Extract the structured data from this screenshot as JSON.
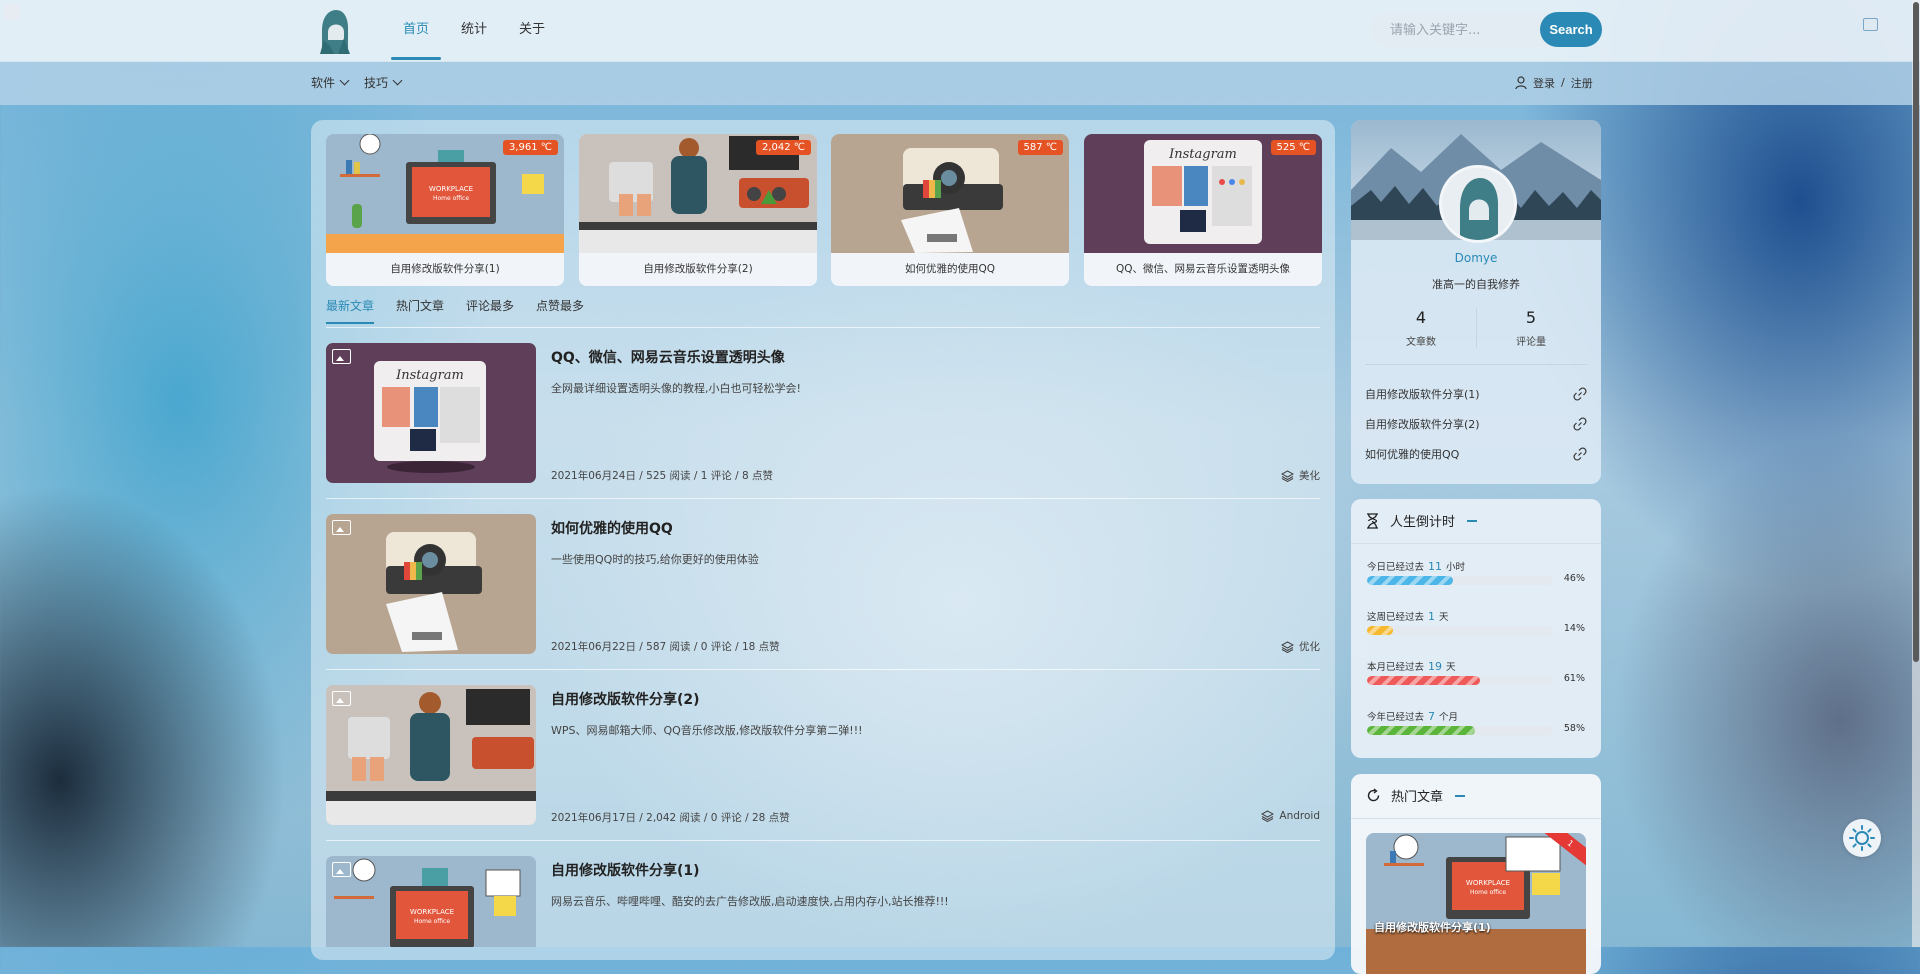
{
  "nav": {
    "items": [
      {
        "label": "首页",
        "active": true
      },
      {
        "label": "统计"
      },
      {
        "label": "关于"
      }
    ]
  },
  "search": {
    "placeholder": "请输入关键字...",
    "button": "Search"
  },
  "submenu": [
    {
      "label": "软件"
    },
    {
      "label": "技巧"
    }
  ],
  "auth": {
    "login": "登录",
    "sep": "/",
    "register": "注册"
  },
  "featured": [
    {
      "title": "自用修改版软件分享(1)",
      "temp": "3,961 ℃"
    },
    {
      "title": "自用修改版软件分享(2)",
      "temp": "2,042 ℃"
    },
    {
      "title": "如何优雅的使用QQ",
      "temp": "587 ℃"
    },
    {
      "title": "QQ、微信、网易云音乐设置透明头像",
      "temp": "525 ℃"
    }
  ],
  "tabs": [
    {
      "label": "最新文章",
      "active": true
    },
    {
      "label": "热门文章"
    },
    {
      "label": "评论最多"
    },
    {
      "label": "点赞最多"
    }
  ],
  "posts": [
    {
      "title": "QQ、微信、网易云音乐设置透明头像",
      "desc": "全网最详细设置透明头像的教程,小白也可轻松学会!",
      "meta": "2021年06月24日 / 525 阅读 / 1 评论 / 8 点赞",
      "tag": "美化"
    },
    {
      "title": "如何优雅的使用QQ",
      "desc": "一些使用QQ时的技巧,给你更好的使用体验",
      "meta": "2021年06月22日 / 587 阅读 / 0 评论 / 18 点赞",
      "tag": "优化"
    },
    {
      "title": "自用修改版软件分享(2)",
      "desc": "WPS、网易邮箱大师、QQ音乐修改版,修改版软件分享第二弹!!!",
      "meta": "2021年06月17日 / 2,042 阅读 / 0 评论 / 28 点赞",
      "tag": "Android"
    },
    {
      "title": "自用修改版软件分享(1)",
      "desc": "网易云音乐、哔哩哔哩、酷安的去广告修改版,启动速度快,占用内存小,站长推荐!!!",
      "meta": "",
      "tag": ""
    }
  ],
  "profile": {
    "name": "Domye",
    "motto": "准高一的自我修养",
    "articles": {
      "value": "4",
      "label": "文章数"
    },
    "comments": {
      "value": "5",
      "label": "评论量"
    },
    "links": [
      "自用修改版软件分享(1)",
      "自用修改版软件分享(2)",
      "如何优雅的使用QQ"
    ]
  },
  "countdown": {
    "title": "人生倒计时",
    "rows": [
      {
        "prefix": "今日已经过去",
        "num": "11",
        "unit": "小时",
        "percent": 46,
        "pct_text": "46%",
        "color": "#4db6e8"
      },
      {
        "prefix": "这周已经过去",
        "num": "1",
        "unit": "天",
        "percent": 14,
        "pct_text": "14%",
        "color": "#f5b82e"
      },
      {
        "prefix": "本月已经过去",
        "num": "19",
        "unit": "天",
        "percent": 61,
        "pct_text": "61%",
        "color": "#ee5a5a"
      },
      {
        "prefix": "今年已经过去",
        "num": "7",
        "unit": "个月",
        "percent": 58,
        "pct_text": "58%",
        "color": "#5bb53a"
      }
    ]
  },
  "hot": {
    "title": "热门文章",
    "cover_title": "自用修改版软件分享(1)",
    "rank": "1"
  },
  "colors": {
    "accent": "#2a8ab5",
    "temp_badge": "#e55325"
  },
  "icons": {
    "theme": "sun-icon",
    "user": "user-icon",
    "tag": "layers-icon",
    "link": "link-icon"
  }
}
